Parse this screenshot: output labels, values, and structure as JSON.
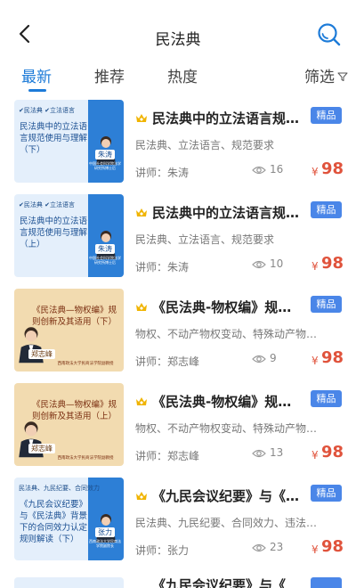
{
  "header": {
    "title": "民法典",
    "back_icon": "chevron-left-icon",
    "search_icon": "search-icon"
  },
  "tabs": [
    {
      "label": "最新",
      "active": true
    },
    {
      "label": "推荐",
      "active": false
    },
    {
      "label": "热度",
      "active": false
    }
  ],
  "filter": {
    "label": "筛选",
    "icon": "filter-icon"
  },
  "colors": {
    "accent": "#1d7bd8",
    "badge": "#4a86e8",
    "price": "#e0533c",
    "crown": "#f0b400"
  },
  "courses": [
    {
      "title": "民法典中的立法语言规范使用与理解（下）",
      "badge": "精品",
      "tags": "民法典、立法语言、规范要求",
      "lecturer": "讲师：朱涛",
      "views": "16",
      "currency": "¥",
      "price": "98",
      "thumb": {
        "style": "blue",
        "tags": "✔民法典  ✔立法语言",
        "title": "民法典中的立法语言规范使用与理解（下）",
        "name": "朱涛",
        "org": "中国社会科学院法学研究所博士后"
      }
    },
    {
      "title": "民法典中的立法语言规范使用与理解（上）",
      "badge": "精品",
      "tags": "民法典、立法语言、规范要求",
      "lecturer": "讲师：朱涛",
      "views": "10",
      "currency": "¥",
      "price": "98",
      "thumb": {
        "style": "blue",
        "tags": "✔民法典  ✔立法语言",
        "title": "民法典中的立法语言规范使用与理解（上）",
        "name": "朱涛",
        "org": "中国社会科学院法学研究所博士后"
      }
    },
    {
      "title": "《民法典-物权编》规则创新及其适用（下）",
      "badge": "精品",
      "tags": "物权、不动产物权变动、特殊动产物权变动",
      "lecturer": "讲师：郑志峰",
      "views": "9",
      "currency": "¥",
      "price": "98",
      "thumb": {
        "style": "gold",
        "tags": "",
        "title": "《民法典—物权编》规则创新及其适用（下）",
        "name": "郑志峰",
        "org": "西南政法大学民商法学院副教授"
      }
    },
    {
      "title": "《民法典-物权编》规则创新及其适用（上）",
      "badge": "精品",
      "tags": "物权、不动产物权变动、特殊动产物权变动",
      "lecturer": "讲师：郑志峰",
      "views": "13",
      "currency": "¥",
      "price": "98",
      "thumb": {
        "style": "gold",
        "tags": "",
        "title": "《民法典—物权编》规则创新及其适用（上）",
        "name": "郑志峰",
        "org": "西南政法大学民商法学院副教授"
      }
    },
    {
      "title": "《九民会议纪要》与《民法典》背景下的合同效力认定规则解读（下）",
      "badge": "精品",
      "tags": "民法典、九民纪要、合同效力、违法合同",
      "lecturer": "讲师：张力",
      "views": "23",
      "currency": "¥",
      "price": "98",
      "thumb": {
        "style": "blue",
        "tags": "民法典、九民纪要、合同效力",
        "title": "《九民会议纪要》与《民法典》背景下的合同效力认定规则解读（下）",
        "name": "张力",
        "org": "西南政法大学民商法学院副院长"
      }
    }
  ],
  "partial_course": {
    "title": "《九民会议纪要》与《"
  }
}
